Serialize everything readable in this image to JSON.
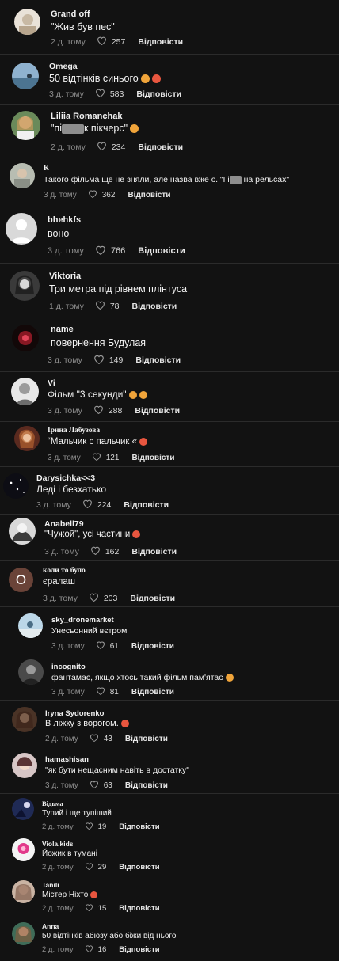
{
  "comments": [
    {
      "name": "Grand off",
      "text": "\"Жив був пес\"",
      "time": "2 д. тому",
      "likes": "257",
      "reply": "Відповісти"
    },
    {
      "name": "Omega",
      "text": "50 відтінків синього",
      "time": "3 д. тому",
      "likes": "583",
      "reply": "Відповісти"
    },
    {
      "name": "Liliia Romanchak",
      "text_a": "\"пі",
      "text_b": "к пікчерс\"",
      "time": "2 д. тому",
      "likes": "234",
      "reply": "Відповісти"
    },
    {
      "name": "К",
      "text_a": "Такого фільма ще не зняли, але назва вже є. \"Гі",
      "text_b": " на рельсах\"",
      "time": "3 д. тому",
      "likes": "362",
      "reply": "Відповісти"
    },
    {
      "name": "bhehkfs",
      "text": "воно",
      "time": "3 д. тому",
      "likes": "766",
      "reply": "Відповісти"
    },
    {
      "name": "Viktoria",
      "text": "Три метра під рівнем плінтуса",
      "time": "1 д. тому",
      "likes": "78",
      "reply": "Відповісти"
    },
    {
      "name": "name",
      "text": "повернення Будулая",
      "time": "3 д. тому",
      "likes": "149",
      "reply": "Відповісти"
    },
    {
      "name": "Vi",
      "text": "Фільм \"3 секунди\"",
      "time": "3 д. тому",
      "likes": "288",
      "reply": "Відповісти"
    },
    {
      "name": "Ірина Лабузова",
      "text": "“Мальчик с пальчик «",
      "time": "3 д. тому",
      "likes": "121",
      "reply": "Відповісти"
    },
    {
      "name": "Darysichka<<3",
      "text": "Леді і безхатько",
      "time": "3 д. тому",
      "likes": "224",
      "reply": "Відповісти"
    },
    {
      "name": "Anabell79",
      "text": "\"Чужой\", усі частини",
      "time": "3 д. тому",
      "likes": "162",
      "reply": "Відповісти"
    },
    {
      "name": "коли то було",
      "avatar_letter": "O",
      "text": "єралаш",
      "time": "3 д. тому",
      "likes": "203",
      "reply": "Відповісти"
    },
    {
      "name": "sky_dronemarket",
      "text": "Унесьонний вєтром",
      "time": "3 д. тому",
      "likes": "61",
      "reply": "Відповісти"
    },
    {
      "name": "incognito",
      "text": "фантамас, якщо хтось такий фільм пам'ятає",
      "time": "3 д. тому",
      "likes": "81",
      "reply": "Відповісти"
    },
    {
      "name": "Iryna Sydorenko",
      "text": "В ліжку з ворогом.",
      "time": "2 д. тому",
      "likes": "43",
      "reply": "Відповісти"
    },
    {
      "name": "hamashisan",
      "text": "\"як бути нещасним навіть в достатку\"",
      "time": "3 д. тому",
      "likes": "63",
      "reply": "Відповісти"
    },
    {
      "name": "Відьма",
      "text": "Тупий і ще тупіший",
      "time": "2 д. тому",
      "likes": "19",
      "reply": "Відповісти"
    },
    {
      "name": "Viola.kids",
      "text": "Йожик в тумані",
      "time": "2 д. тому",
      "likes": "29",
      "reply": "Відповісти"
    },
    {
      "name": "Tanili",
      "text": "Містер Ніхто",
      "time": "2 д. тому",
      "likes": "15",
      "reply": "Відповісти"
    },
    {
      "name": "Anna",
      "text": "50 відтінків абюзу або біжи від нього",
      "time": "2 д. тому",
      "likes": "16",
      "reply": "Відповісти"
    }
  ],
  "colors": {
    "background": "#121212",
    "separator": "#2b2b2b",
    "muted": "#8e8e8e",
    "emoji": "#f0a43a"
  }
}
